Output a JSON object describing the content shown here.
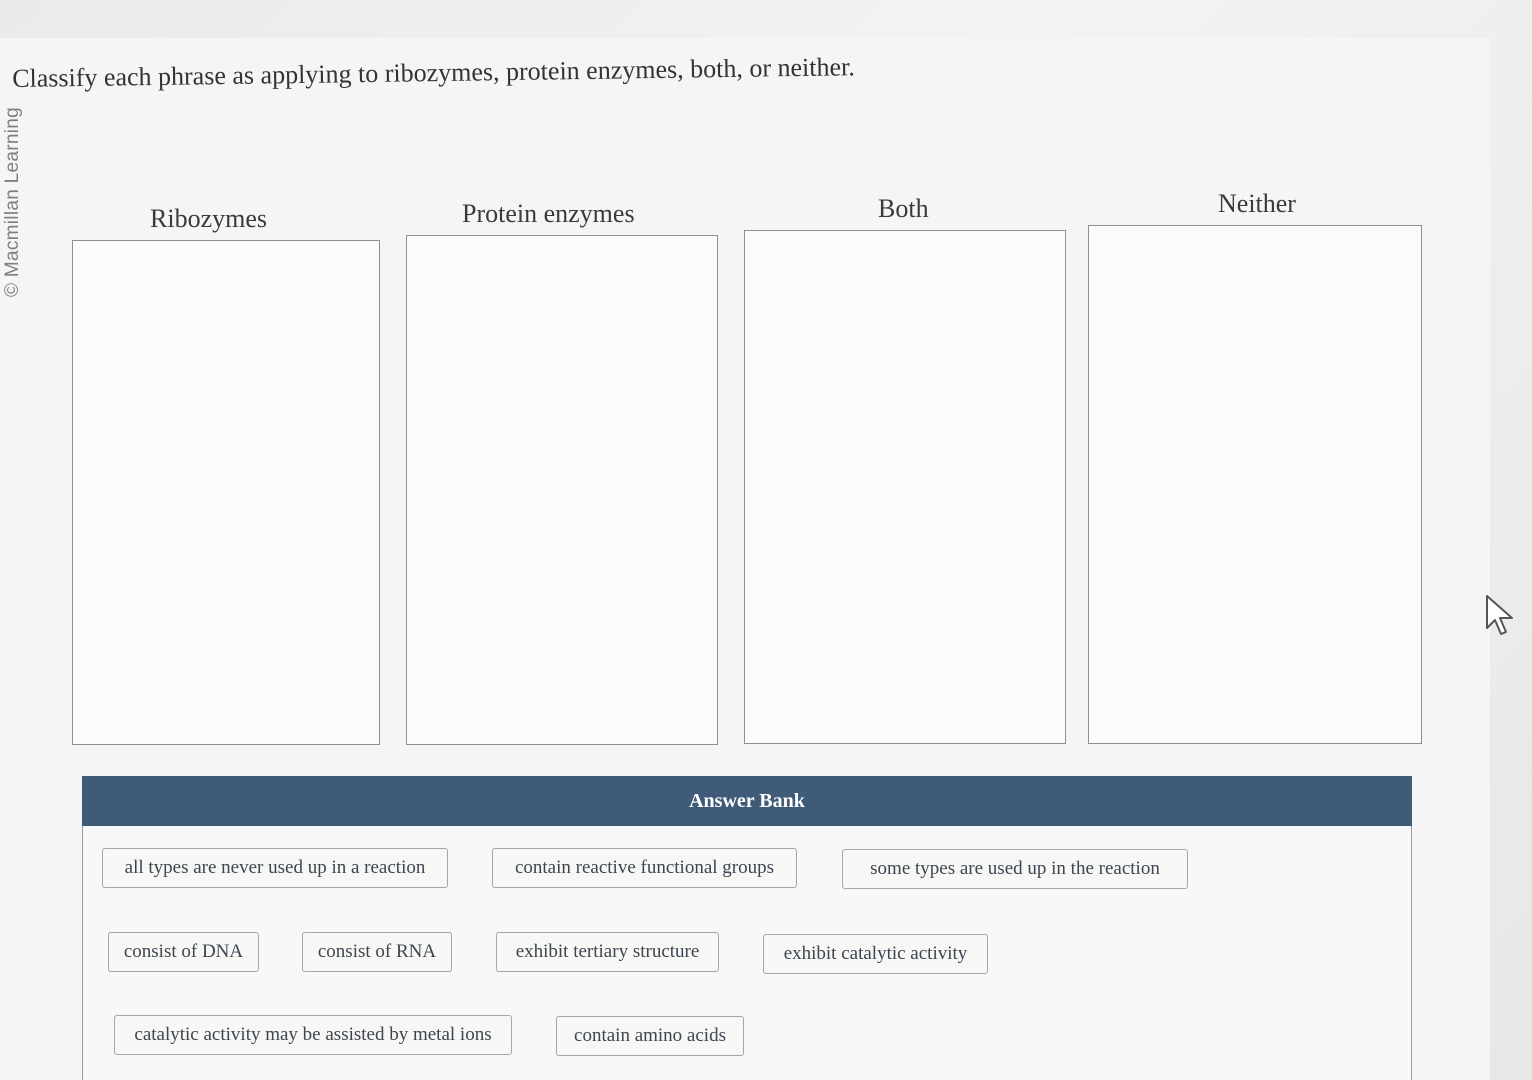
{
  "watermark": "© Macmillan Learning",
  "prompt": "Classify each phrase as applying to ribozymes, protein enzymes, both, or neither.",
  "categories": [
    {
      "label": "Ribozymes"
    },
    {
      "label": "Protein enzymes"
    },
    {
      "label": "Both"
    },
    {
      "label": "Neither"
    }
  ],
  "answer_bank": {
    "title": "Answer Bank",
    "items": [
      "all types are never used up in a reaction",
      "contain reactive functional groups",
      "some types are used up in the reaction",
      "consist of DNA",
      "consist of RNA",
      "exhibit tertiary structure",
      "exhibit catalytic activity",
      "catalytic activity may be assisted by metal ions",
      "contain amino acids"
    ]
  },
  "colors": {
    "bank_header": "#3f5b78",
    "chip_border": "#a5a7a8"
  },
  "icons": {
    "pointer": "mouse-pointer-icon"
  }
}
